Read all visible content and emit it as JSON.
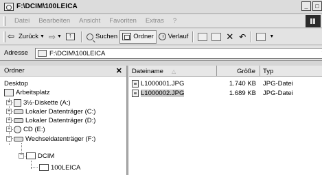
{
  "window": {
    "title": "F:\\DCIM\\100LEICA",
    "controls": [
      "_",
      "□"
    ]
  },
  "menu": [
    "Datei",
    "Bearbeiten",
    "Ansicht",
    "Favoriten",
    "Extras",
    "?"
  ],
  "toolbar": {
    "back": "Zurück",
    "forward_arrow": "⇨",
    "search": "Suchen",
    "folders": "Ordner",
    "history": "Verlauf",
    "delete_glyph": "✕",
    "undo_glyph": "↶"
  },
  "address": {
    "label": "Adresse",
    "value": "F:\\DCIM\\100LEICA"
  },
  "folder_pane": {
    "title": "Ordner",
    "close_glyph": "✕",
    "tree": [
      {
        "label": "Desktop",
        "icon": "desktop-icon",
        "expander": ""
      },
      {
        "label": "Arbeitsplatz",
        "icon": "computer-icon",
        "expander": ""
      },
      {
        "label": "3½-Diskette (A:)",
        "icon": "floppy-icon",
        "expander": "+"
      },
      {
        "label": "Lokaler Datenträger (C:)",
        "icon": "drive-icon",
        "expander": "+"
      },
      {
        "label": "Lokaler Datenträger (D:)",
        "icon": "drive-icon",
        "expander": "+"
      },
      {
        "label": "CD (E:)",
        "icon": "cd-icon",
        "expander": "+"
      },
      {
        "label": "Wechseldatenträger (F:)",
        "icon": "removable-drive-icon",
        "expander": "−"
      },
      {
        "label": "DCIM",
        "icon": "folder-icon",
        "expander": "−"
      },
      {
        "label": "100LEICA",
        "icon": "folder-icon",
        "expander": ""
      }
    ]
  },
  "file_list": {
    "columns": {
      "name": "Dateiname",
      "size": "Größe",
      "type": "Typ",
      "sort_indicator": "△"
    },
    "rows": [
      {
        "name": "L1000001.JPG",
        "size": "1.740 KB",
        "type": "JPG-Datei",
        "selected": false
      },
      {
        "name": "L1000002.JPG",
        "size": "1.689 KB",
        "type": "JPG-Datei",
        "selected": true
      }
    ]
  }
}
